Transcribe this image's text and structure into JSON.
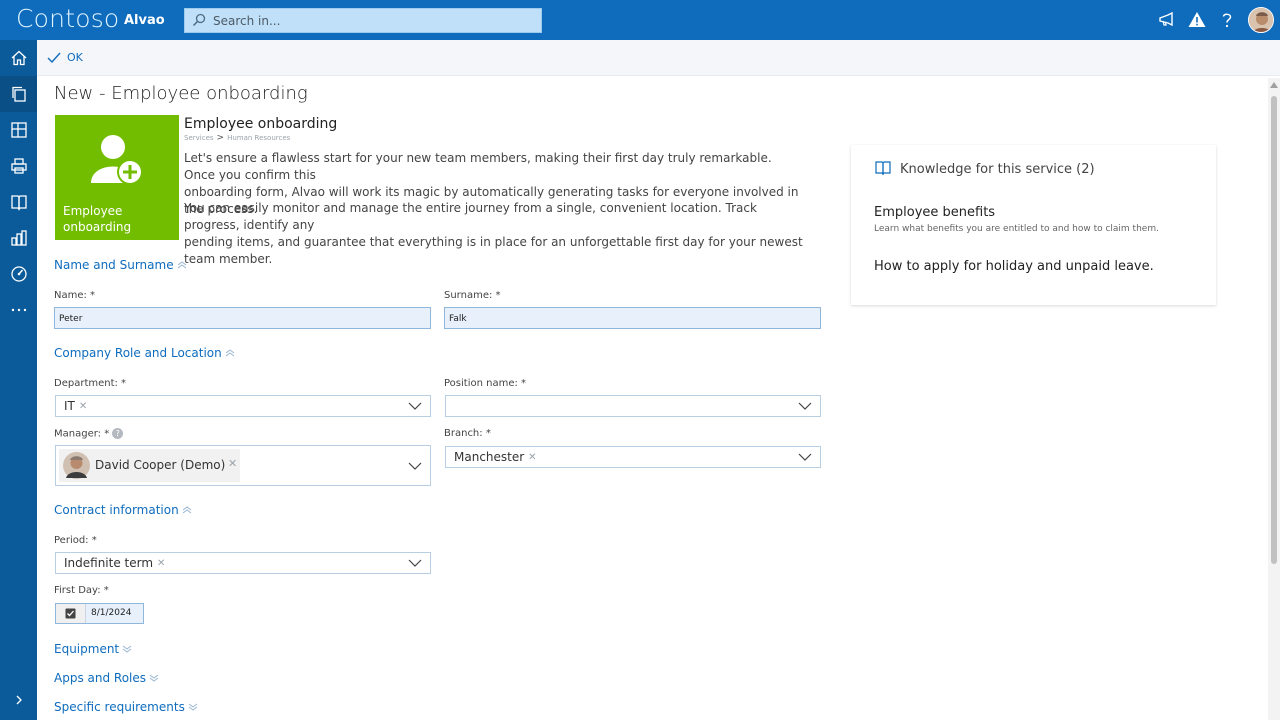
{
  "header": {
    "brand": "Contoso",
    "app_name": "Alvao",
    "search_placeholder": "Search in..."
  },
  "toolbar": {
    "ok_label": "OK"
  },
  "page": {
    "title": "New - Employee onboarding"
  },
  "service": {
    "tile_label": "Employee onboarding",
    "title": "Employee onboarding",
    "breadcrumb": [
      "Services",
      "Human Resources"
    ],
    "desc1_line1": "Let's ensure a flawless start for your new team members, making their first day truly remarkable. Once you confirm this",
    "desc1_line2": "onboarding form, Alvao will work its magic by automatically generating tasks for everyone involved in the process.",
    "desc2_line1": "You can easily monitor and manage the entire journey from a single, convenient location. Track progress, identify any",
    "desc2_line2": "pending items, and guarantee that everything is in place for an unforgettable first day for your newest team member."
  },
  "sections": {
    "name": "Name and Surname",
    "role": "Company Role and Location",
    "contract": "Contract information",
    "equipment": "Equipment",
    "apps": "Apps and Roles",
    "specific": "Specific requirements"
  },
  "form": {
    "name_label": "Name: *",
    "name_value": "Peter",
    "surname_label": "Surname: *",
    "surname_value": "Falk",
    "department_label": "Department: *",
    "department_value": "IT",
    "position_label": "Position name: *",
    "manager_label": "Manager: *",
    "manager_value": "David Cooper (Demo)",
    "branch_label": "Branch: *",
    "branch_value": "Manchester",
    "period_label": "Period: *",
    "period_value": "Indefinite term",
    "firstday_label": "First Day: *",
    "firstday_value": "8/1/2024"
  },
  "knowledge": {
    "title": "Knowledge for this service (2)",
    "item1_title": "Employee benefits",
    "item1_sub": "Learn what benefits you are entitled to and how to claim them.",
    "item2_title": "How to apply for holiday and unpaid leave."
  },
  "colors": {
    "header": "#0f6cbd",
    "sidebar": "#0b5b9a",
    "tile": "#73bd00",
    "link": "#0f6cbd"
  }
}
